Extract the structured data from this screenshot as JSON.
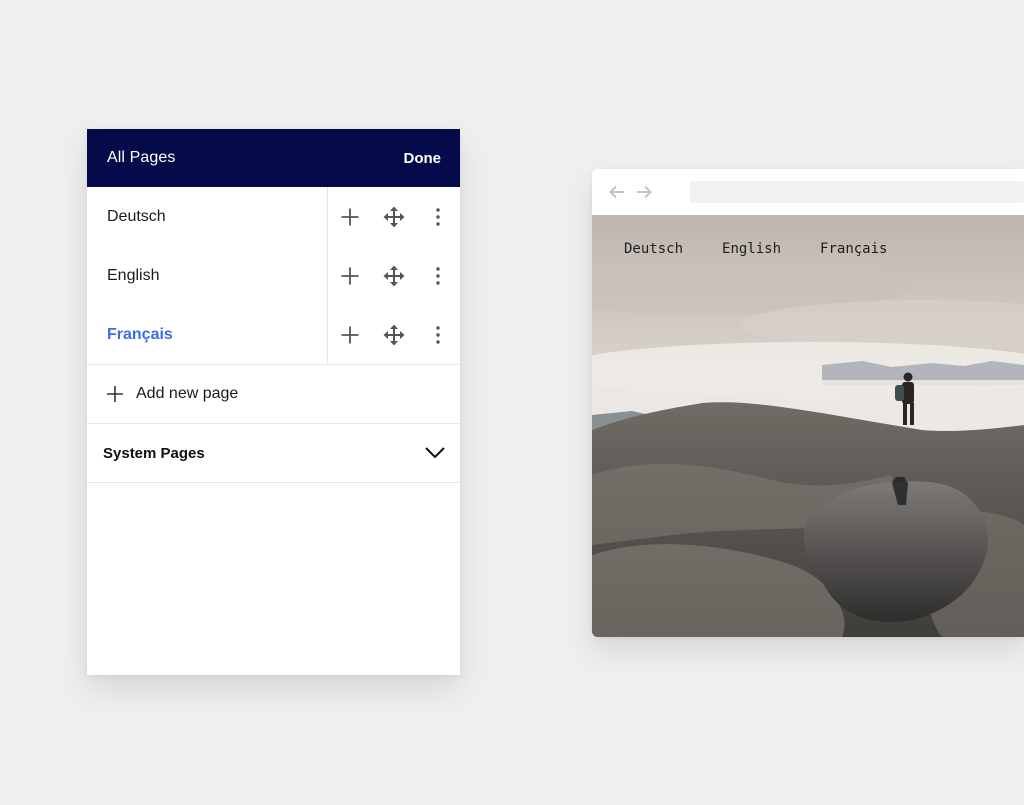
{
  "panel": {
    "title": "All Pages",
    "done_label": "Done",
    "pages": [
      {
        "label": "Deutsch",
        "active": false
      },
      {
        "label": "English",
        "active": false
      },
      {
        "label": "Français",
        "active": true
      }
    ],
    "add_label": "Add new page",
    "system_label": "System Pages",
    "colors": {
      "header_bg": "#050a4a",
      "active_text": "#3a6de6"
    }
  },
  "browser": {
    "nav_links": [
      "Deutsch",
      "English",
      "Français"
    ]
  }
}
